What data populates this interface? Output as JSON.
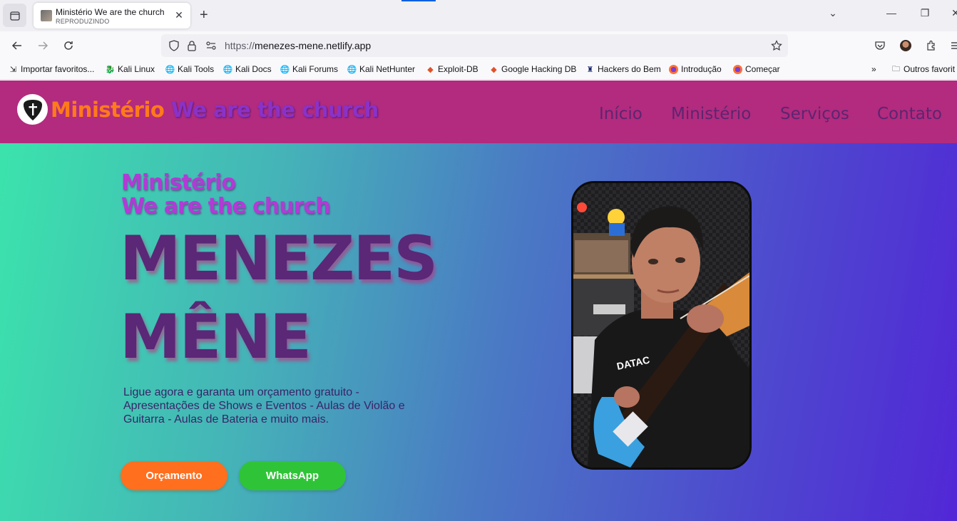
{
  "browser": {
    "tab": {
      "title": "Ministério We are the church",
      "subtitle": "REPRODUZINDO"
    },
    "url": {
      "protocol": "https://",
      "host": "menezes-mene.netlify.app"
    },
    "bookmarks": [
      {
        "label": "Importar favoritos...",
        "icon": "import-icon"
      },
      {
        "label": "Kali Linux",
        "icon": "kali-icon"
      },
      {
        "label": "Kali Tools",
        "icon": "globe-icon"
      },
      {
        "label": "Kali Docs",
        "icon": "globe-icon"
      },
      {
        "label": "Kali Forums",
        "icon": "globe-icon"
      },
      {
        "label": "Kali NetHunter",
        "icon": "globe-icon"
      },
      {
        "label": "Exploit-DB",
        "icon": "exploitdb-icon"
      },
      {
        "label": "Google Hacking DB",
        "icon": "exploitdb-icon"
      },
      {
        "label": "Hackers do Bem",
        "icon": "hackers-icon"
      },
      {
        "label": "Introdução",
        "icon": "firefox-icon"
      },
      {
        "label": "Começar",
        "icon": "firefox-icon"
      }
    ],
    "other_bookmarks": "Outros favorit"
  },
  "site": {
    "brand_part1": "Ministério",
    "brand_part2": "We are the church",
    "menu": [
      "Início",
      "Ministério",
      "Serviços",
      "Contato"
    ],
    "hero": {
      "sub1": "Ministério",
      "sub2": "We are the church",
      "name1": "MENEZES",
      "name2": "MÊNE",
      "description": "Ligue agora e garanta um orçamento gratuito - Apresentações de Shows e Eventos - Aulas de Violão e Guitarra - Aulas de Bateria e muito mais.",
      "btn_quote": "Orçamento",
      "btn_whatsapp": "WhatsApp"
    }
  },
  "colors": {
    "header_bg": "#b22b7e",
    "brand_orange": "#ff7a1a",
    "brand_purple": "#8a32c8",
    "hero_start": "#3be3ac",
    "hero_end": "#5227d6",
    "btn_quote": "#ff6f1e",
    "btn_whatsapp": "#2fc437"
  }
}
